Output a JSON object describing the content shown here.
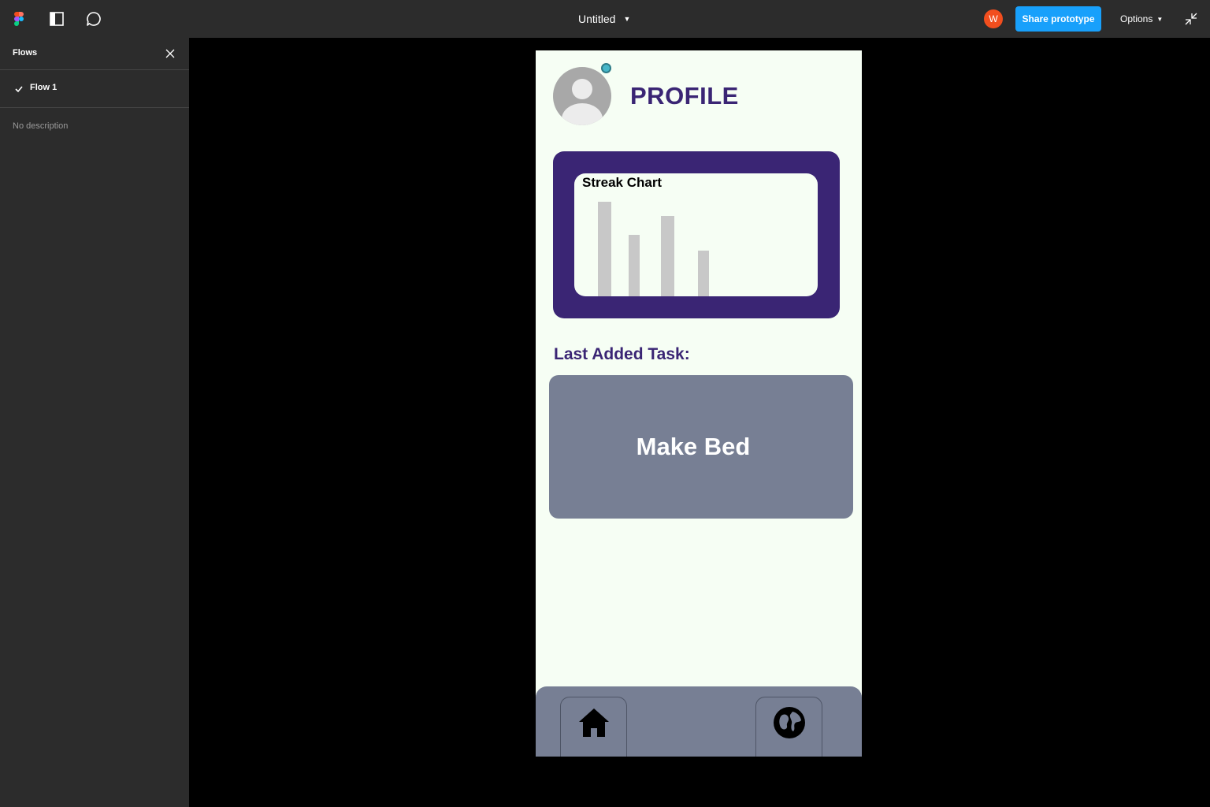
{
  "app": {
    "file_title": "Untitled",
    "user_initial": "W",
    "share_label": "Share prototype",
    "options_label": "Options",
    "icons": [
      "figma-logo-icon",
      "panel-toggle-icon",
      "comment-icon",
      "chevron-down-icon",
      "collapse-icon",
      "close-icon",
      "check-icon"
    ]
  },
  "sidebar": {
    "title": "Flows",
    "flows": [
      {
        "label": "Flow 1",
        "selected": true
      }
    ],
    "description": "No description"
  },
  "prototype": {
    "page_title": "PROFILE",
    "status_color": "#46b6c8",
    "streak": {
      "title": "Streak Chart",
      "chart_data": {
        "type": "bar",
        "title": "Streak Chart",
        "values": [
          120,
          78,
          102,
          58
        ],
        "bar_color": "#c8c8c8"
      }
    },
    "last_task_label": "Last Added Task:",
    "last_task_title": "Make Bed",
    "nav": [
      {
        "icon": "home-icon"
      },
      {
        "icon": "globe-icon"
      }
    ]
  },
  "colors": {
    "accent_purple": "#3a2574",
    "card_gray": "#777f94",
    "screen_bg": "#f6fef4",
    "share_blue": "#18a0fb",
    "user_orange": "#f24e1e"
  }
}
